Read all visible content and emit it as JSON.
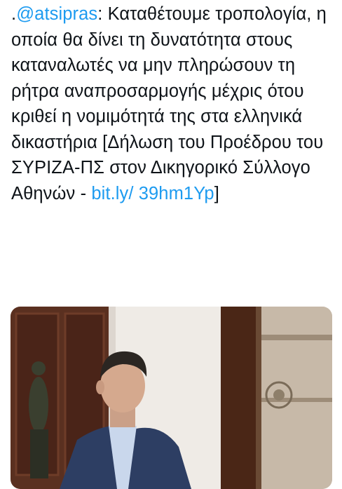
{
  "tweet": {
    "prefix": ".",
    "mention": "@atsipras",
    "body": ": Καταθέτουμε τροπολογία, η οποία θα δίνει τη δυνατότητα στους καταναλωτές να μην πληρώσουν τη ρήτρα αναπροσαρμογής μέχρις ότου κριθεί η νομιμότητά της στα ελληνικά δικαστήρια [Δήλωση του Προέδρου του ΣΥΡΙΖΑ-ΠΣ στον Δικηγορικό Σύλλογο Αθηνών - ",
    "link": "bit.ly/ 39hm1Yp",
    "suffix": "]"
  },
  "media": {
    "description_icon": "photo",
    "colors": {
      "wood": "#5a3020",
      "wall": "#efebe6",
      "suit": "#2d3e63",
      "shirt": "#c9d7ec"
    }
  }
}
